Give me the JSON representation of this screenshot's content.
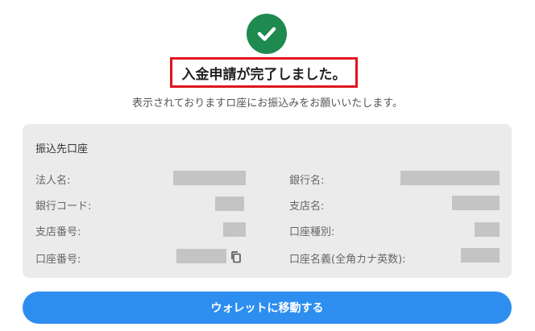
{
  "colors": {
    "success_green": "#1e8a4f",
    "highlight_red": "#e0141e",
    "panel_bg": "#ebebeb",
    "button_blue": "#2d8ef0",
    "masked_gray": "#c4c4c4"
  },
  "icons": {
    "success": "check-circle-icon",
    "copy": "copy-icon"
  },
  "header": {
    "title": "入金申請が完了しました。",
    "subtitle": "表示されておりますロ座にお振込みをお願いいたします。"
  },
  "account_panel": {
    "heading": "振込先口座",
    "fields": {
      "corporate_name": "法人名:",
      "bank_name": "銀行名:",
      "bank_code": "銀行コード:",
      "branch_name": "支店名:",
      "branch_number": "支店番号:",
      "account_type": "口座種別:",
      "account_number": "口座番号:",
      "account_holder_kana": "口座名義(全角カナ英数):"
    }
  },
  "actions": {
    "wallet_button": "ウォレットに移動する"
  }
}
